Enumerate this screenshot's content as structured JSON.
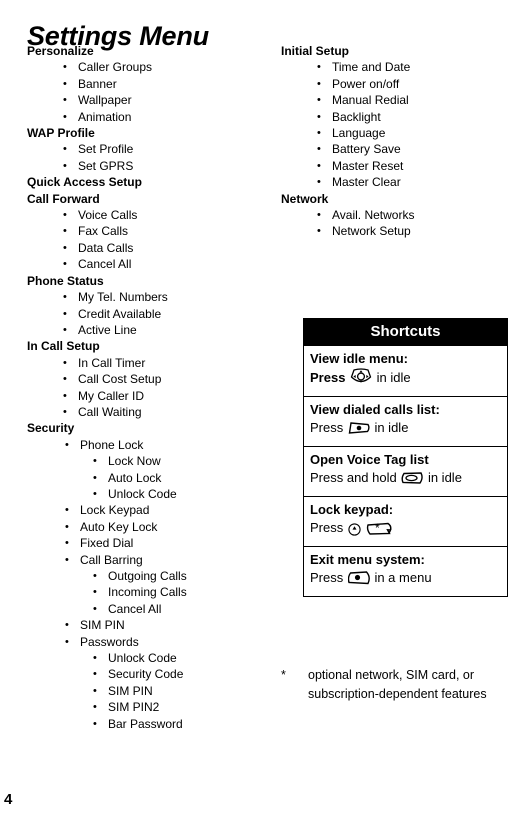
{
  "document": {
    "title": "Settings Menu",
    "page_number": "4"
  },
  "left_column": [
    {
      "heading": "Personalize",
      "items": [
        {
          "label": "Caller Groups"
        },
        {
          "label": "Banner"
        },
        {
          "label": "Wallpaper"
        },
        {
          "label": "Animation"
        }
      ]
    },
    {
      "heading": "WAP Profile",
      "items": [
        {
          "label": "Set Profile"
        },
        {
          "label": "Set GPRS"
        }
      ]
    },
    {
      "heading": "Quick Access Setup",
      "items": []
    },
    {
      "heading": "Call Forward",
      "items": [
        {
          "label": "Voice Calls"
        },
        {
          "label": "Fax Calls"
        },
        {
          "label": "Data Calls"
        },
        {
          "label": "Cancel All"
        }
      ]
    },
    {
      "heading": "Phone Status",
      "items": [
        {
          "label": "My Tel. Numbers"
        },
        {
          "label": "Credit Available"
        },
        {
          "label": "Active Line"
        }
      ]
    },
    {
      "heading": "In Call Setup",
      "items": [
        {
          "label": "In Call Timer"
        },
        {
          "label": "Call Cost Setup"
        },
        {
          "label": "My Caller ID"
        },
        {
          "label": "Call Waiting"
        }
      ]
    },
    {
      "heading": "Security",
      "offset": true,
      "items": [
        {
          "label": "Phone Lock",
          "children": [
            {
              "label": "Lock Now"
            },
            {
              "label": "Auto Lock"
            },
            {
              "label": "Unlock Code"
            }
          ]
        },
        {
          "label": "Lock Keypad"
        },
        {
          "label": "Auto Key Lock"
        },
        {
          "label": "Fixed Dial"
        },
        {
          "label": "Call Barring",
          "children": [
            {
              "label": "Outgoing Calls"
            },
            {
              "label": "Incoming Calls"
            },
            {
              "label": "Cancel All"
            }
          ]
        },
        {
          "label": "SIM PIN"
        },
        {
          "label": "Passwords",
          "children": [
            {
              "label": "Unlock Code"
            },
            {
              "label": "Security Code"
            },
            {
              "label": "SIM PIN"
            },
            {
              "label": "SIM PIN2"
            },
            {
              "label": "Bar Password"
            }
          ]
        }
      ]
    }
  ],
  "right_column": [
    {
      "heading": "Initial Setup",
      "items": [
        {
          "label": "Time and Date"
        },
        {
          "label": "Power on/off"
        },
        {
          "label": "Manual Redial"
        },
        {
          "label": "Backlight"
        },
        {
          "label": "Language"
        },
        {
          "label": "Battery Save"
        },
        {
          "label": "Master Reset"
        },
        {
          "label": "Master Clear"
        }
      ]
    },
    {
      "heading": "Network",
      "items": [
        {
          "label": "Avail. Networks"
        },
        {
          "label": "Network Setup"
        }
      ]
    }
  ],
  "shortcuts": {
    "header": "Shortcuts",
    "rows": [
      {
        "title": "View idle menu:",
        "title_bold": true,
        "press_label": "Press",
        "press_bold": true,
        "icon": "navigation-key-icon",
        "suffix": "in idle",
        "suffix_bold": false
      },
      {
        "title": "View dialed calls list:",
        "title_bold": true,
        "press_label": "Press",
        "press_bold": false,
        "icon": "send-key-icon",
        "suffix": "in idle",
        "suffix_bold": false
      },
      {
        "title": "Open Voice Tag list",
        "title_bold": true,
        "press_label": "Press and hold",
        "press_bold": false,
        "icon": "voice-key-icon",
        "suffix": "in idle",
        "suffix_bold": false
      },
      {
        "title": "Lock keypad:",
        "title_bold": true,
        "press_label": "Press",
        "press_bold": false,
        "icon": "menu-key-icon",
        "icon2": "star-key-icon",
        "suffix": "",
        "suffix_bold": false
      },
      {
        "title": "Exit menu system:",
        "title_bold": true,
        "press_label": "Press",
        "press_bold": false,
        "icon": "power-end-key-icon",
        "suffix": "in a menu",
        "suffix_bold": false
      }
    ]
  },
  "footnote": {
    "marker": "*",
    "text": "optional network, SIM card, or subscription-dependent features"
  },
  "colors": {
    "text": "#000000",
    "background": "#ffffff",
    "table_header_bg": "#000000",
    "table_header_text": "#ffffff",
    "table_border": "#000000"
  }
}
